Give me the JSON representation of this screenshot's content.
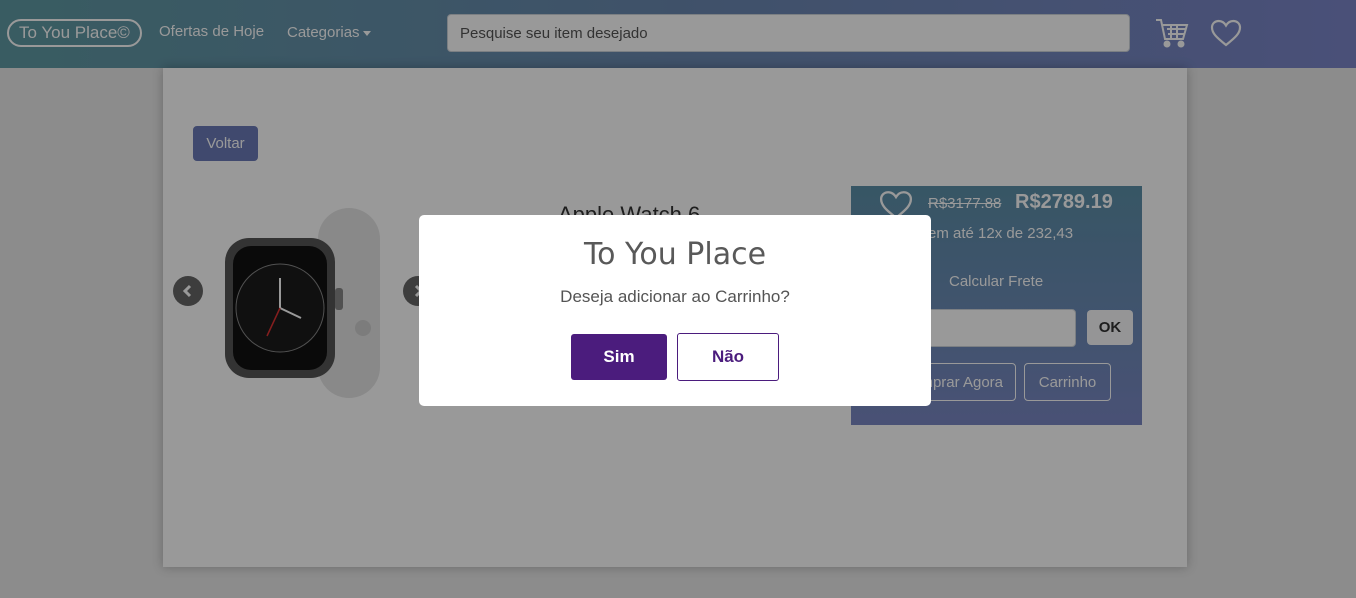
{
  "navbar": {
    "brand": "To You Place©",
    "offers_link": "Ofertas de Hoje",
    "categories_link": "Categorias",
    "search_placeholder": "Pesquise seu item desejado",
    "cart_icon": "cart-icon",
    "favorites_icon": "heart-icon"
  },
  "page": {
    "back_label": "Voltar",
    "product_title": "Apple Watch 6",
    "product_image_icon": "smartwatch-image"
  },
  "buy_panel": {
    "old_price": "R$3177.88",
    "new_price": "R$2789.19",
    "installments": "em até 12x de 232,43",
    "calc_frete": "Calcular Frete",
    "ok_label": "OK",
    "buy_now_label": "Comprar Agora",
    "cart_label": "Carrinho"
  },
  "modal": {
    "title": "To You Place",
    "message": "Deseja adicionar ao Carrinho?",
    "confirm_label": "Sim",
    "cancel_label": "Não"
  },
  "colors": {
    "navbar_start": "#5f9aa3",
    "navbar_end": "#7c86c9",
    "modal_primary": "#4b1c7d",
    "back_button": "#6b7ab8"
  }
}
